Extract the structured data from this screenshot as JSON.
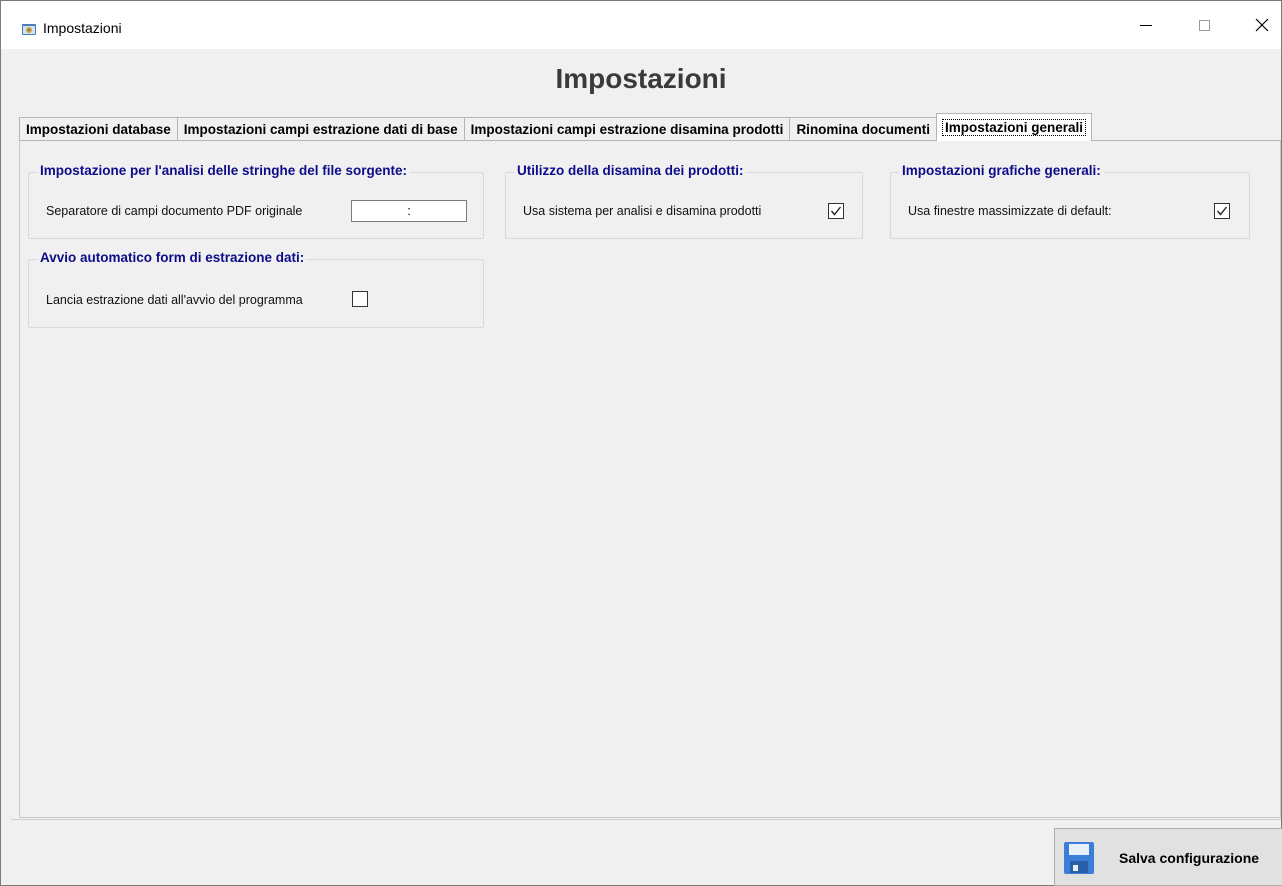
{
  "window": {
    "title": "Impostazioni"
  },
  "heading": "Impostazioni",
  "tabs": [
    {
      "label": "Impostazioni database",
      "active": false
    },
    {
      "label": "Impostazioni campi estrazione dati di base",
      "active": false
    },
    {
      "label": "Impostazioni campi estrazione disamina prodotti",
      "active": false
    },
    {
      "label": "Rinomina documenti",
      "active": false
    },
    {
      "label": "Impostazioni generali",
      "active": true
    }
  ],
  "groups": {
    "string_analysis": {
      "title": "Impostazione per l'analisi delle stringhe del file sorgente:",
      "separator_label": "Separatore di campi documento PDF originale",
      "separator_value": ":"
    },
    "product_review": {
      "title": "Utilizzo della disamina dei prodotti:",
      "checkbox_label": "Usa sistema per analisi e disamina prodotti",
      "checked": true
    },
    "graphics": {
      "title": "Impostazioni grafiche generali:",
      "checkbox_label": "Usa finestre massimizzate di default:",
      "checked": true
    },
    "autostart": {
      "title": "Avvio automatico form di estrazione dati:",
      "checkbox_label": "Lancia estrazione dati all'avvio del programma",
      "checked": false
    }
  },
  "footer": {
    "save_label": "Salva configurazione"
  },
  "colors": {
    "group_title": "#0c0c8a",
    "heading": "#3a3a3a",
    "floppy": "#3b7dd8"
  },
  "icons": {
    "app": "settings-window-icon",
    "save": "floppy-disk-icon",
    "checkmark": "checkmark-icon"
  }
}
